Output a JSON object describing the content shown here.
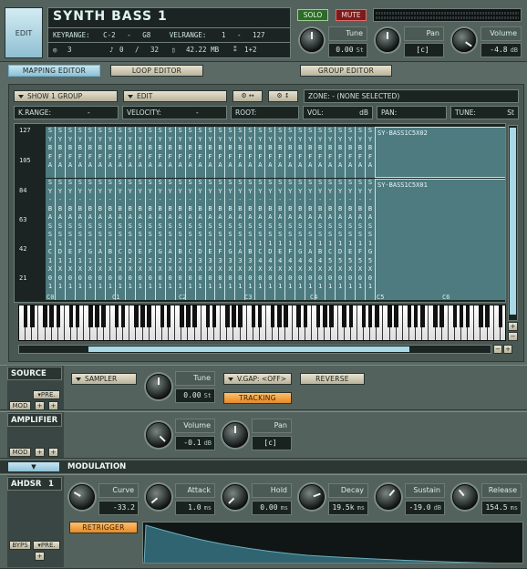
{
  "header": {
    "edit_label": "EDIT",
    "instrument_name": "SYNTH BASS 1",
    "solo_label": "SOLO",
    "mute_label": "MUTE",
    "keyrange_label": "KEYRANGE:",
    "keyrange_low": "C-2",
    "keyrange_dash": "-",
    "keyrange_high": "G8",
    "velrange_label": "VELRANGE:",
    "velrange_low": "1",
    "velrange_dash": "-",
    "velrange_high": "127",
    "voices": "3",
    "notes_value": "0",
    "notes_max": "32",
    "memory": "42.22 MB",
    "channel": "1+2",
    "tune_label": "Tune",
    "tune_value": "0.00",
    "tune_unit": "St",
    "pan_label": "Pan",
    "pan_value": "[c]",
    "volume_label": "Volume",
    "volume_value": "-4.8",
    "volume_unit": "dB"
  },
  "editors": {
    "mapping": "MAPPING EDITOR",
    "loop": "LOOP EDITOR",
    "group": "GROUP EDITOR"
  },
  "mapping": {
    "show_group": "SHOW 1 GROUP",
    "edit": "EDIT",
    "zone_label": "ZONE: - (NONE SELECTED)",
    "krange_label": "K.RANGE:",
    "krange_value": "-",
    "velocity_label": "VELOCITY:",
    "velocity_value": "-",
    "root_label": "ROOT:",
    "vol_label": "VOL:",
    "vol_unit": "dB",
    "pan_label": "PAN:",
    "tune_label": "TUNE:",
    "tune_unit": "St",
    "y_ticks": [
      "127",
      "105",
      "84",
      "63",
      "42",
      "21"
    ],
    "upper_zone_label": "SY-BASS1C5X02",
    "lower_zone_label": "SY-BASS1C5X01",
    "octave_labels": [
      "C0",
      "C1",
      "C2",
      "C3",
      "C4",
      "C5",
      "C6"
    ],
    "upper_columns": [
      "SY",
      "SY",
      "SY",
      "SY",
      "SY",
      "SY",
      "SY",
      "SY",
      "SY",
      "SY",
      "SY",
      "SY",
      "SY",
      "SY",
      "SY",
      "SY",
      "SY",
      "SY",
      "SY",
      "SY",
      "SY",
      "SY",
      "SY",
      "SY",
      "SY",
      "SY",
      "SY",
      "SY",
      "SY",
      "SY",
      "SY",
      "SY",
      "SY"
    ],
    "upper_suffix": [
      "BFA",
      "BFA",
      "BFA",
      "BFA",
      "BFA",
      "BFA",
      "BFA",
      "BFA",
      "BFA",
      "BFA",
      "BFA",
      "BFA",
      "BFA",
      "BFA",
      "BFA",
      "BFA",
      "BFA",
      "BFA",
      "BFA",
      "BFA",
      "BFA",
      "BFA",
      "BFA",
      "BFA",
      "BFA",
      "BFA",
      "BFA",
      "BFA",
      "BFA",
      "BFA",
      "BFA",
      "BFA",
      "BFA"
    ],
    "lower_notes": [
      "C",
      "D",
      "E",
      "F",
      "G",
      "A",
      "B",
      "C",
      "D",
      "E",
      "F",
      "G",
      "A",
      "B",
      "C",
      "D",
      "E",
      "F",
      "G",
      "A",
      "B",
      "C",
      "D",
      "E",
      "F",
      "G",
      "A",
      "B",
      "C",
      "D",
      "E",
      "F",
      "G"
    ],
    "lower_oct": [
      "1",
      "1",
      "1",
      "1",
      "1",
      "1",
      "1",
      "2",
      "2",
      "2",
      "2",
      "2",
      "2",
      "2",
      "3",
      "3",
      "3",
      "3",
      "3",
      "3",
      "3",
      "4",
      "4",
      "4",
      "4",
      "4",
      "4",
      "4",
      "5",
      "5",
      "5",
      "5",
      "5"
    ]
  },
  "source": {
    "title": "SOURCE",
    "mod": "MOD",
    "pre": "PRE.",
    "sampler": "SAMPLER",
    "tune_label": "Tune",
    "tune_value": "0.00",
    "tune_unit": "St",
    "vgap": "V.GAP: <OFF>",
    "reverse": "REVERSE",
    "tracking": "TRACKING"
  },
  "amplifier": {
    "title": "AMPLIFIER",
    "mod": "MOD",
    "volume_label": "Volume",
    "volume_value": "-0.1",
    "volume_unit": "dB",
    "pan_label": "Pan",
    "pan_value": "[c]"
  },
  "modulation": {
    "title": "MODULATION",
    "ahdsr": "AHDSR",
    "ahdsr_num": "1",
    "byps": "BYPS",
    "pre": "PRE.",
    "retrigger": "RETRIGGER",
    "curve_label": "Curve",
    "curve_value": "-33.2",
    "attack_label": "Attack",
    "attack_value": "1.0",
    "attack_unit": "ms",
    "hold_label": "Hold",
    "hold_value": "0.00",
    "hold_unit": "ms",
    "decay_label": "Decay",
    "decay_value": "19.5k",
    "decay_unit": "ms",
    "sustain_label": "Sustain",
    "sustain_value": "-19.0",
    "sustain_unit": "dB",
    "release_label": "Release",
    "release_value": "154.5",
    "release_unit": "ms"
  },
  "colors": {
    "accent_orange": "#f0a040",
    "zone_teal": "#4d7b80",
    "panel_dark": "#1a2220"
  }
}
